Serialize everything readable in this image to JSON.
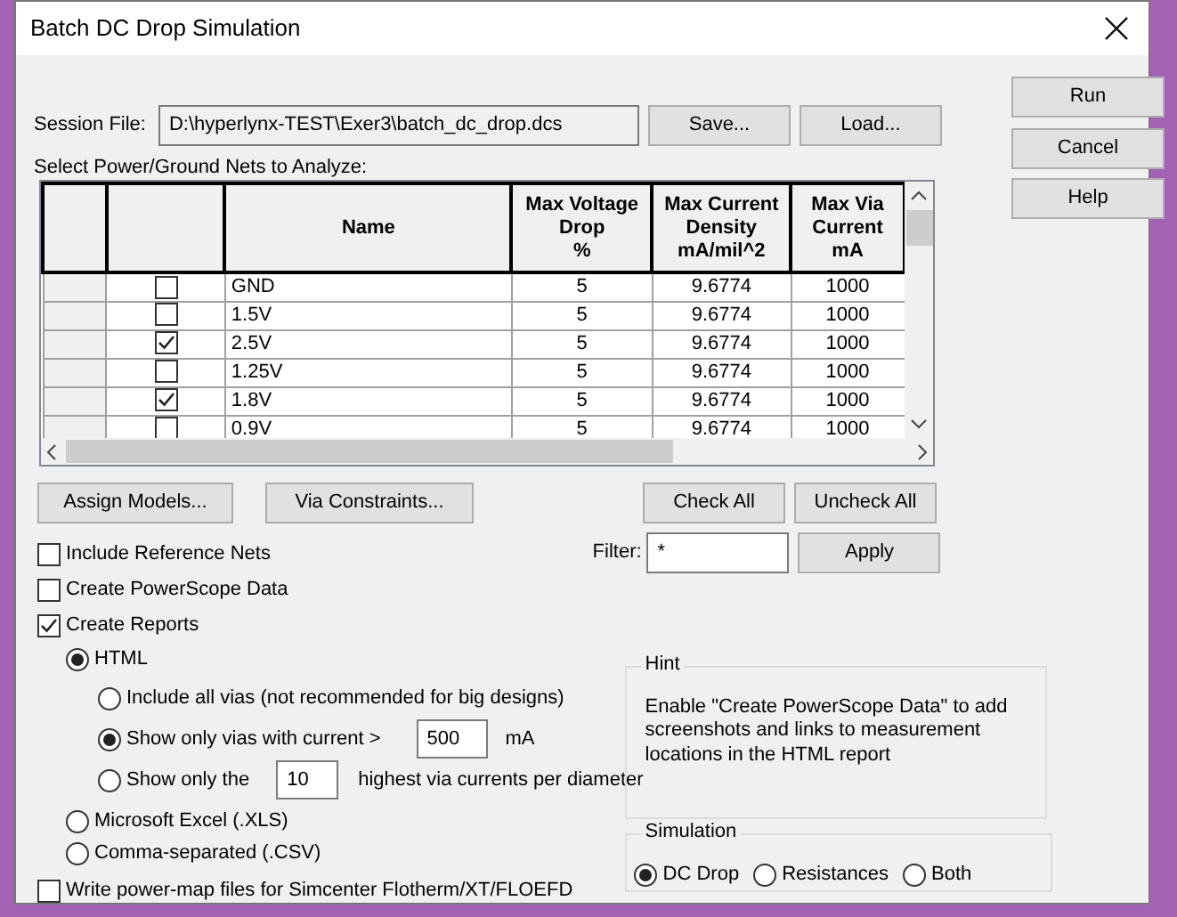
{
  "window": {
    "title": "Batch DC Drop Simulation"
  },
  "session_file": {
    "label": "Session File:",
    "value": "D:\\hyperlynx-TEST\\Exer3\\batch_dc_drop.dcs"
  },
  "session_buttons": [
    "Save...",
    "Load..."
  ],
  "side_buttons": [
    "Run",
    "Cancel",
    "Help"
  ],
  "nets": {
    "label": "Select Power/Ground Nets to Analyze:",
    "columns": [
      "Name",
      "Max Voltage\nDrop\n%",
      "Max Current\nDensity\nmA/mil^2",
      "Max Via\nCurrent\nmA"
    ],
    "rows": [
      {
        "checked": false,
        "name": "GND",
        "max_voltage_drop": "5",
        "max_current_density": "9.6774",
        "max_via_current": "1000"
      },
      {
        "checked": false,
        "name": "1.5V",
        "max_voltage_drop": "5",
        "max_current_density": "9.6774",
        "max_via_current": "1000"
      },
      {
        "checked": true,
        "name": "2.5V",
        "max_voltage_drop": "5",
        "max_current_density": "9.6774",
        "max_via_current": "1000"
      },
      {
        "checked": false,
        "name": "1.25V",
        "max_voltage_drop": "5",
        "max_current_density": "9.6774",
        "max_via_current": "1000"
      },
      {
        "checked": true,
        "name": "1.8V",
        "max_voltage_drop": "5",
        "max_current_density": "9.6774",
        "max_via_current": "1000"
      },
      {
        "checked": false,
        "name": "0.9V",
        "max_voltage_drop": "5",
        "max_current_density": "9.6774",
        "max_via_current": "1000"
      }
    ]
  },
  "table_buttons": [
    "Assign Models...",
    "Via Constraints..."
  ],
  "check_buttons": [
    "Check All",
    "Uncheck All"
  ],
  "filter": {
    "label": "Filter:",
    "value": "*",
    "button": "Apply"
  },
  "options": [
    {
      "label": "Include Reference Nets",
      "checked": false
    },
    {
      "label": "Create PowerScope Data",
      "checked": false
    },
    {
      "label": "Create Reports",
      "checked": true
    }
  ],
  "report_formats": [
    {
      "label": "HTML",
      "selected": true,
      "via_options": [
        {
          "kind": "plain",
          "label": "Include all vias (not recommended for big designs)",
          "selected": false
        },
        {
          "kind": "threshold",
          "label": "Show only vias with current >",
          "value": "500",
          "unit": "mA",
          "selected": true
        },
        {
          "kind": "top_n",
          "label": "Show only the",
          "value": "10",
          "suffix": "highest via currents per diameter",
          "selected": false
        }
      ]
    },
    {
      "label": "Microsoft Excel (.XLS)",
      "selected": false
    },
    {
      "label": "Comma-separated (.CSV)",
      "selected": false
    }
  ],
  "power_map": {
    "label": "Write power-map files for Simcenter Flotherm/XT/FLOEFD",
    "checked": false
  },
  "hint": {
    "title": "Hint",
    "text": "Enable \"Create PowerScope Data\" to add screenshots and links to measurement locations in the HTML report"
  },
  "simulation": {
    "title": "Simulation",
    "options": [
      {
        "label": "DC Drop",
        "selected": true
      },
      {
        "label": "Resistances",
        "selected": false
      },
      {
        "label": "Both",
        "selected": false
      }
    ]
  }
}
